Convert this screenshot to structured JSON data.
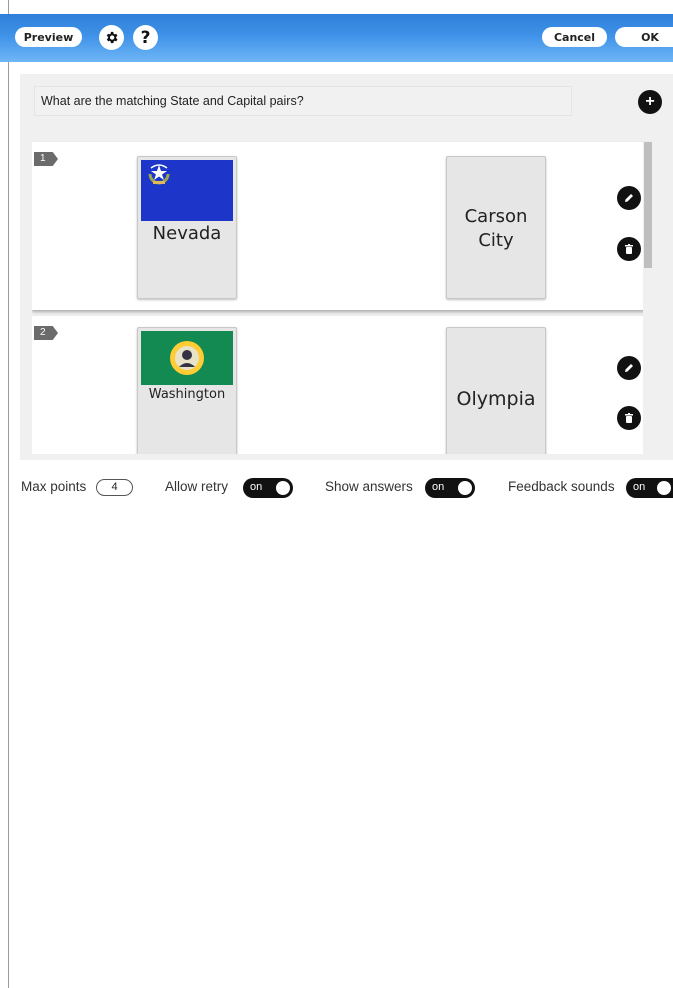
{
  "toolbar": {
    "preview_label": "Preview",
    "help_glyph": "?",
    "cancel_label": "Cancel",
    "ok_label": "OK",
    "gradient_colors": [
      "#2f7fd9",
      "#6fb6f5"
    ]
  },
  "question": {
    "text": "What are the matching State and Capital pairs?",
    "add_icon": "plus-icon"
  },
  "pairs": [
    {
      "number": "1",
      "left_label": "Nevada",
      "left_flag": "nevada-flag",
      "right_label_line1": "Carson",
      "right_label_line2": "City"
    },
    {
      "number": "2",
      "left_label": "Washington",
      "left_flag": "washington-flag",
      "right_label": "Olympia"
    }
  ],
  "settings": {
    "max_points_label": "Max points",
    "max_points_value": "4",
    "allow_retry_label": "Allow retry",
    "allow_retry_state": "on",
    "show_answers_label": "Show answers",
    "show_answers_state": "on",
    "feedback_sounds_label": "Feedback sounds",
    "feedback_sounds_state": "on"
  }
}
